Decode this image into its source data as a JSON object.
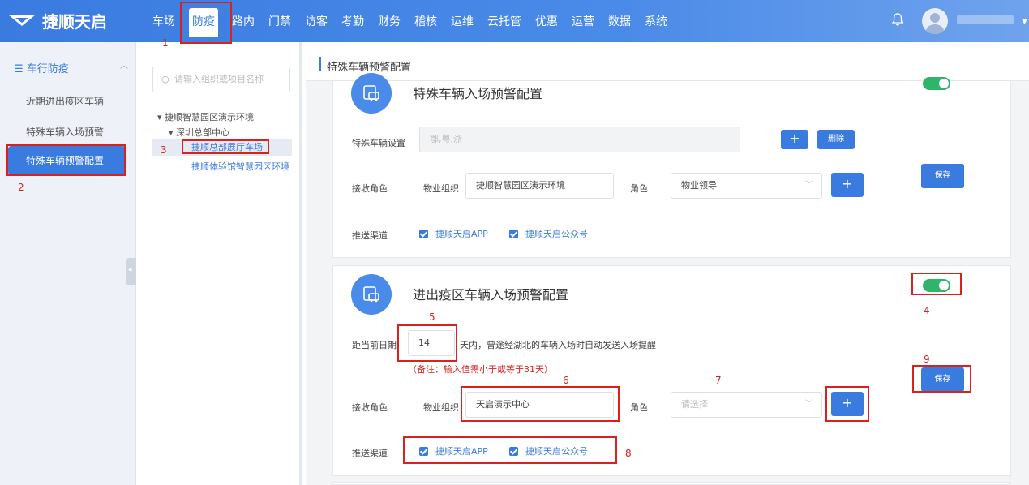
{
  "brand": {
    "name": "捷顺天启"
  },
  "nav": {
    "items": [
      "车场",
      "防疫",
      "路内",
      "门禁",
      "访客",
      "考勤",
      "财务",
      "稽核",
      "运维",
      "云托管",
      "优惠",
      "运营",
      "数据",
      "系统"
    ],
    "active": "防疫"
  },
  "sidebar": {
    "section": "车行防疫",
    "items": [
      "近期进出疫区车辆",
      "特殊车辆入场预警",
      "特殊车辆预警配置"
    ],
    "active": "特殊车辆预警配置"
  },
  "tree": {
    "search_placeholder": "请输入组织或项目名称",
    "root": "捷顺智慧园区演示环境",
    "child": "深圳总部中心",
    "leaf_selected": "捷顺总部展厅车场",
    "leaf_other": "捷顺体验馆智慧园区环境"
  },
  "breadcrumb": "特殊车辆预警配置",
  "card1": {
    "title": "特殊车辆入场预警配置",
    "vehicle_label": "特殊车辆设置",
    "vehicle_value": "鄂,粤,浙",
    "delete_label": "删除",
    "role_label": "接收角色",
    "org_label": "物业组织",
    "org_value": "捷顺智慧园区演示环境",
    "role_select_label": "角色",
    "role_value": "物业领导",
    "save_label": "保存",
    "channel_label": "推送渠道",
    "channel_app": "捷顺天启APP",
    "channel_wechat": "捷顺天启公众号",
    "enabled": true
  },
  "card2": {
    "title": "进出疫区车辆入场预警配置",
    "days_label": "距当前日期",
    "days_value": "14",
    "days_suffix": "天内，曾途经湖北的车辆入场时自动发送入场提醒",
    "note": "（备注：输入值需小于或等于31天）",
    "role_label": "接收角色",
    "org_label": "物业组织",
    "org_value": "天启演示中心",
    "role_select_label": "角色",
    "role_placeholder": "请选择",
    "save_label": "保存",
    "channel_label": "推送渠道",
    "channel_app": "捷顺天启APP",
    "channel_wechat": "捷顺天启公众号",
    "enabled": true
  },
  "plus_label": "+",
  "annotations": [
    "1",
    "2",
    "3",
    "4",
    "5",
    "6",
    "7",
    "8",
    "9"
  ],
  "colors": {
    "primary": "#3a7be0",
    "toggle_on": "#2fb46b",
    "annotation": "#d9221f"
  }
}
